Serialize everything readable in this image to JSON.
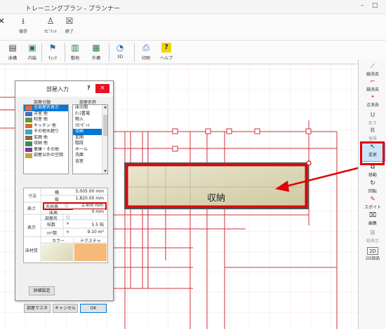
{
  "window": {
    "title": "トレーニングプラン - プランナー",
    "controls": [
      "–",
      "□"
    ]
  },
  "toolbar1": [
    {
      "label": "保存",
      "icon": "save-icon"
    },
    {
      "label": "ﾅﾋﾞｹｯﾄ",
      "icon": "navigator-icon"
    },
    {
      "label": "終了",
      "icon": "exit-icon"
    }
  ],
  "toolbar2": [
    {
      "label": "床構",
      "icon": "floor-icon"
    },
    {
      "label": "内装",
      "icon": "interior-icon"
    },
    {
      "label": "ﾁｪｯｸ",
      "icon": "check-icon"
    },
    {
      "label": "敷地",
      "icon": "site-icon"
    },
    {
      "label": "外構",
      "icon": "exterior-icon"
    },
    {
      "label": "3D",
      "icon": "3d-icon"
    },
    {
      "label": "印刷",
      "icon": "print-icon"
    },
    {
      "label": "ヘルプ",
      "icon": "help-icon"
    }
  ],
  "right_panel": [
    {
      "label": "線消去",
      "icon": "line-erase-icon",
      "state": "normal"
    },
    {
      "label": "箱消去",
      "icon": "box-erase-icon",
      "state": "normal"
    },
    {
      "label": "点消去",
      "icon": "point-erase-icon",
      "state": "normal"
    },
    {
      "label": "戻す",
      "icon": "undo-icon",
      "state": "disabled"
    },
    {
      "label": "復帰",
      "icon": "redo-icon",
      "state": "disabled"
    },
    {
      "label": "変更",
      "icon": "cursor-icon",
      "state": "active"
    },
    {
      "label": "移動",
      "icon": "move-icon",
      "state": "normal"
    },
    {
      "label": "回転",
      "icon": "rotate-icon",
      "state": "normal"
    },
    {
      "label": "スポイト",
      "icon": "eyedropper-icon",
      "state": "normal"
    },
    {
      "label": "編集",
      "icon": "edit-icon",
      "state": "normal"
    },
    {
      "label": "総表示",
      "icon": "view-all-icon",
      "state": "disabled"
    },
    {
      "label": "2D部品",
      "icon": "2d-parts-icon",
      "state": "normal"
    }
  ],
  "canvas": {
    "room_label": "収納"
  },
  "dialog": {
    "title": "部屋入力",
    "help": "?",
    "close": "×",
    "category_header": "部屋分類",
    "name_header": "部屋名称",
    "categories": [
      {
        "label": "全部屋名表示",
        "color": "#e06a3a",
        "selected": true
      },
      {
        "label": "洋室 他",
        "color": "#3c6fc7",
        "selected": false
      },
      {
        "label": "和室 他",
        "color": "#5a9a3a",
        "selected": false
      },
      {
        "label": "キッチン 他",
        "color": "#d66a2a",
        "selected": false
      },
      {
        "label": "その他水廻り",
        "color": "#3aa7c7",
        "selected": false
      },
      {
        "label": "玄関 他",
        "color": "#8a6a3a",
        "selected": false
      },
      {
        "label": "収納 他",
        "color": "#3a8a5a",
        "selected": false
      },
      {
        "label": "車庫・その他",
        "color": "#7a3a9a",
        "selected": false
      },
      {
        "label": "部屋以外の空間",
        "color": "#c7a33a",
        "selected": false
      }
    ],
    "names": [
      {
        "label": "床の間",
        "selected": false
      },
      {
        "label": "ﾀﾝｽ置場",
        "selected": false
      },
      {
        "label": "物入",
        "selected": false
      },
      {
        "label": "ｸﾛｰｾﾞｯﾄ",
        "selected": false
      },
      {
        "label": "収納",
        "selected": true
      },
      {
        "label": "玄関",
        "selected": false
      },
      {
        "label": "階段",
        "selected": false
      },
      {
        "label": "ホール",
        "selected": false
      },
      {
        "label": "洗面",
        "selected": false
      },
      {
        "label": "浴室",
        "selected": false
      }
    ],
    "props": {
      "dim_label": "寸法",
      "width_label": "横",
      "width_value": "5,005.00 mm",
      "depth_label": "縦",
      "depth_value": "1,820.00 mm",
      "height_label": "高さ",
      "ceiling_label": "天井高",
      "ceiling_value": "2,400 mm",
      "floor_label": "床高",
      "floor_value": "0 mm",
      "display_label": "表示",
      "room_name_label": "部屋名",
      "tatami_label": "帖数",
      "tatami_value": "5.5 帖",
      "sqm_label": "m²数",
      "sqm_value": "9.10 m²",
      "material_label": "床材質",
      "color_label": "カラー",
      "texture_label": "テクスチャ",
      "check_on": "○",
      "check_off": "×"
    },
    "detail_button": "詳細設定",
    "master_button": "部屋マスタ",
    "cancel_button": "キャンセル",
    "ok_button": "OK"
  },
  "colors": {
    "highlight": "#e10000",
    "accent": "#0078d7",
    "grid": "#f2b8c6",
    "wall": "#d0303a"
  }
}
